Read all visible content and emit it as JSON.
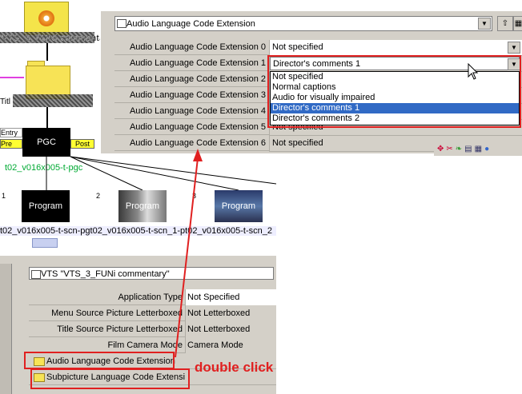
{
  "tree": {
    "vts_label": "VTS_3_FUNi commentary",
    "title_label": "Titl",
    "entry_label": "Entry",
    "pre_label": "Pre",
    "post_label": "Post",
    "pgc_label": "PGC",
    "pgc_name": "t02_v016x005-t-pgc",
    "programs": [
      {
        "num": "1",
        "label": "Program"
      },
      {
        "num": "2",
        "label": "Program"
      },
      {
        "num": "3",
        "label": "Program"
      }
    ],
    "scene_names": "t02_v016x005-t-scn-pgt02_v016x005-t-scn_1-pt02_v016x005-t-scn_2"
  },
  "top_panel": {
    "header": "Audio Language Code Extension",
    "rows": [
      {
        "label": "Audio Language Code Extension 0",
        "value": "Not specified"
      },
      {
        "label": "Audio Language Code Extension 1",
        "value": "Director's comments 1"
      },
      {
        "label": "Audio Language Code Extension 2",
        "value": ""
      },
      {
        "label": "Audio Language Code Extension 3",
        "value": ""
      },
      {
        "label": "Audio Language Code Extension 4",
        "value": ""
      },
      {
        "label": "Audio Language Code Extension 5",
        "value": "Not specified"
      },
      {
        "label": "Audio Language Code Extension 6",
        "value": "Not specified"
      }
    ],
    "dropdown_options": [
      "Not specified",
      "Normal captions",
      "Audio for visually impaired",
      "Director's comments 1",
      "Director's comments 2"
    ],
    "selected_option": "Director's comments 1"
  },
  "bottom_panel": {
    "header": "VTS \"VTS_3_FUNi commentary\"",
    "rows": [
      {
        "label": "Application Type",
        "value": "Not Specified"
      },
      {
        "label": "Menu Source Picture Letterboxed",
        "value": "Not Letterboxed"
      },
      {
        "label": "Title Source Picture Letterboxed",
        "value": "Not Letterboxed"
      },
      {
        "label": "Film Camera Mode",
        "value": "Camera Mode"
      }
    ],
    "folder_rows": [
      "Audio Language Code Extension",
      "Subpicture Language Code Extensi"
    ]
  },
  "annotation": {
    "text": "double click",
    "color": "#e02020"
  },
  "colors": {
    "panel": "#d4d0c8",
    "selection": "#316ac5",
    "folder": "#f7e356"
  }
}
